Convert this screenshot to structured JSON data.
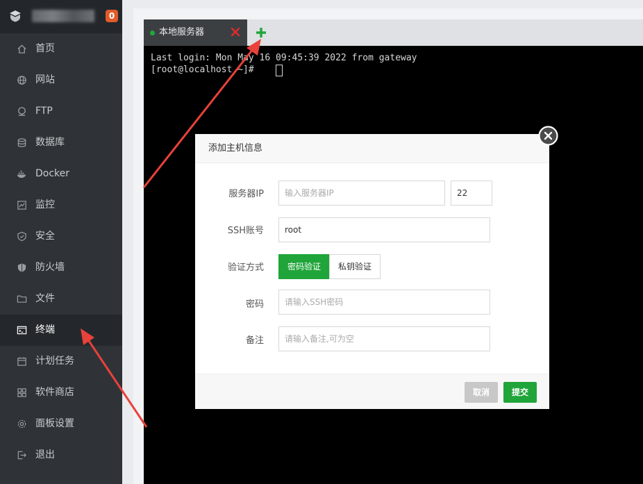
{
  "sidebar": {
    "brand_name": "",
    "badge_count": "0",
    "items": [
      {
        "label": "首页",
        "icon": "home-icon"
      },
      {
        "label": "网站",
        "icon": "globe-icon"
      },
      {
        "label": "FTP",
        "icon": "ftp-icon"
      },
      {
        "label": "数据库",
        "icon": "database-icon"
      },
      {
        "label": "Docker",
        "icon": "docker-icon"
      },
      {
        "label": "监控",
        "icon": "monitor-icon"
      },
      {
        "label": "安全",
        "icon": "shield-icon"
      },
      {
        "label": "防火墙",
        "icon": "firewall-icon"
      },
      {
        "label": "文件",
        "icon": "folder-icon"
      },
      {
        "label": "终端",
        "icon": "terminal-icon"
      },
      {
        "label": "计划任务",
        "icon": "calendar-icon"
      },
      {
        "label": "软件商店",
        "icon": "apps-icon"
      },
      {
        "label": "面板设置",
        "icon": "gear-icon"
      },
      {
        "label": "退出",
        "icon": "logout-icon"
      }
    ],
    "active_item": "终端"
  },
  "terminal": {
    "tab_label": "本地服务器",
    "line1": "Last login: Mon May 16 09:45:39 2022 from gateway",
    "line2": "[root@localhost ~]# "
  },
  "dialog": {
    "title": "添加主机信息",
    "server_ip_label": "服务器IP",
    "server_ip_placeholder": "输入服务器IP",
    "port_value": "22",
    "ssh_user_label": "SSH账号",
    "ssh_user_value": "root",
    "auth_label": "验证方式",
    "auth_option_password": "密码验证",
    "auth_option_key": "私钥验证",
    "password_label": "密码",
    "password_placeholder": "请输入SSH密码",
    "note_label": "备注",
    "note_placeholder": "请输入备注,可为空",
    "cancel_label": "取消",
    "submit_label": "提交"
  },
  "colors": {
    "sidebar_bg": "#2f3337",
    "accent_green": "#20a53a",
    "tab_close_red": "#e02a2a",
    "badge_orange": "#e05b2b",
    "arrow_red": "#e8423a"
  }
}
